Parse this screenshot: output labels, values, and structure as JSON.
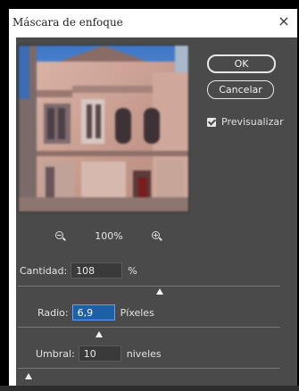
{
  "dialog": {
    "title": "Máscara de enfoque",
    "close_glyph": "×"
  },
  "buttons": {
    "ok": "OK",
    "cancel": "Cancelar"
  },
  "preview_toggle": {
    "label": "Previsualizar",
    "checked": true
  },
  "zoom": {
    "level": "100%",
    "zoom_out_icon": "zoom-out-icon",
    "zoom_in_icon": "zoom-in-icon"
  },
  "cantidad": {
    "label": "Cantidad:",
    "value": "108",
    "unit": "%",
    "slider_fraction": 0.54
  },
  "radio": {
    "label": "Radio:",
    "value": "6,9",
    "unit": "Píxeles",
    "slider_fraction": 0.31
  },
  "umbral": {
    "label": "Umbral:",
    "value": "10",
    "unit": "niveles",
    "slider_fraction": 0.04
  },
  "colors": {
    "panel": "#4a4a4a",
    "active_field": "#1f5fa8"
  }
}
